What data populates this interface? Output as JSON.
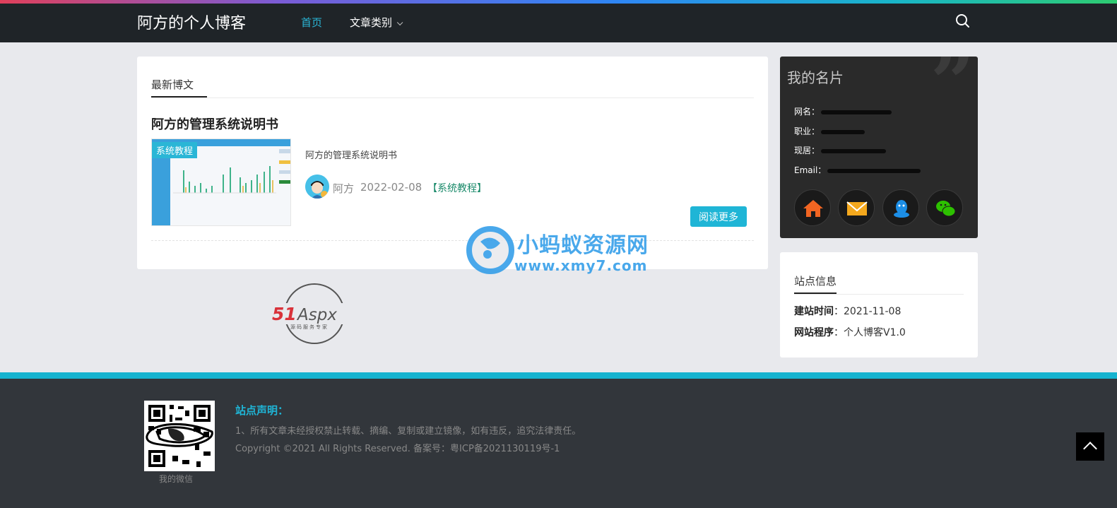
{
  "header": {
    "brand": "阿方的个人博客",
    "nav": {
      "home": "首页",
      "category": "文章类别"
    },
    "search_icon": "search-icon"
  },
  "main": {
    "section_tab": "最新博文",
    "post": {
      "title": "阿方的管理系统说明书",
      "thumb_tag": "系统教程",
      "excerpt": "阿方的管理系统说明书",
      "author": "阿方",
      "date": "2022-02-08",
      "category": "【系统教程】",
      "read_more": "阅读更多"
    }
  },
  "sidebar": {
    "card_title": "我的名片",
    "info": [
      {
        "label": "网名：",
        "value": ""
      },
      {
        "label": "职业：",
        "value": ""
      },
      {
        "label": "现居：",
        "value": ""
      },
      {
        "label": "Email：",
        "value": ""
      }
    ],
    "social_icons": [
      "home-icon",
      "mail-icon",
      "qq-icon",
      "wechat-icon"
    ],
    "site_info": {
      "title": "站点信息",
      "established_label": "建站时间",
      "established_value": "：2021-11-08",
      "program_label": "网站程序",
      "program_value": "：个人博客V1.0"
    }
  },
  "logo": {
    "main": "51Aspx",
    "sub": "源码服务专家"
  },
  "watermark": {
    "name": "小蚂蚁资源网",
    "url": "www.xmy7.com"
  },
  "footer": {
    "qr_label": "我的微信",
    "decl_title": "站点声明：",
    "decl_1": "1、所有文章未经授权禁止转载、摘编、复制或建立镜像，如有违反，追究法律责任。",
    "decl_2": "Copyright ©2021 All Rights Reserved. 备案号：粤ICP备2021130119号-1"
  },
  "colors": {
    "accent": "#1fb5d6",
    "header_bg": "#1f2428",
    "footer_bg": "#32363b",
    "card_dark": "#2a2a2a"
  }
}
